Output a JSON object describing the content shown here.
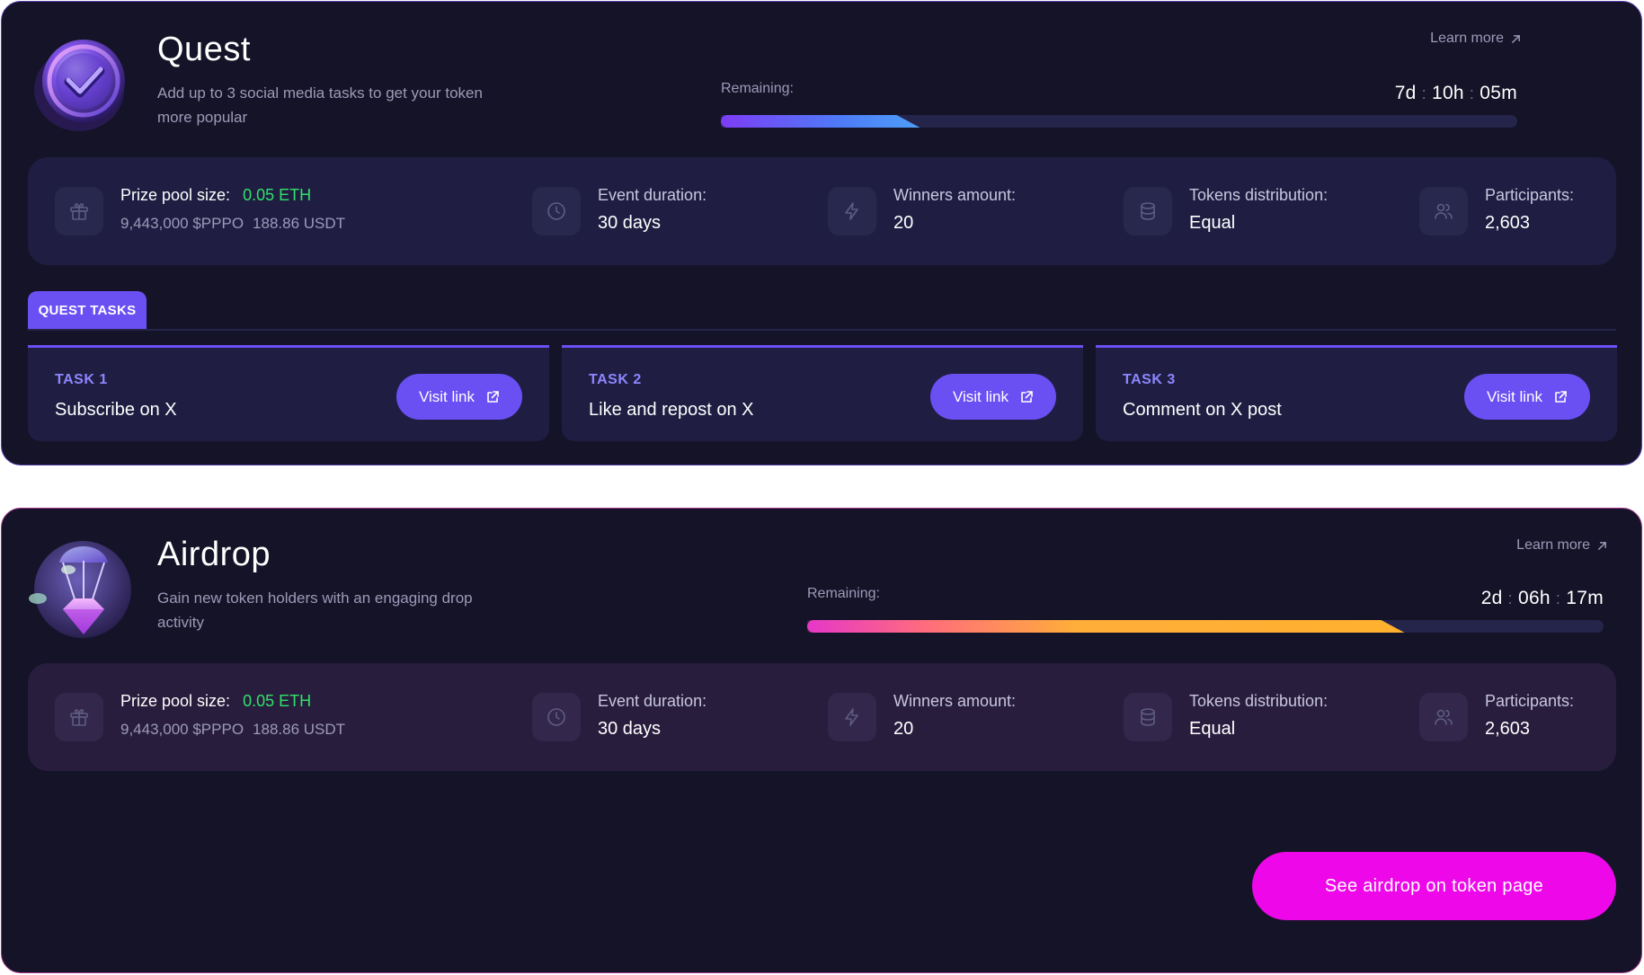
{
  "quest": {
    "title": "Quest",
    "subtitle": "Add up to 3 social media tasks to get your token more popular",
    "learn_more": "Learn more",
    "remaining_label": "Remaining:",
    "timer": {
      "days": "7d",
      "hours": "10h",
      "minutes": "05m"
    },
    "progress_fraction": 0.25,
    "stats": {
      "prize_label": "Prize pool size:",
      "prize_eth": "0.05 ETH",
      "prize_token": "9,443,000 $PPPO",
      "prize_usdt": "188.86 USDT",
      "duration_label": "Event duration:",
      "duration_value": "30 days",
      "winners_label": "Winners amount:",
      "winners_value": "20",
      "distribution_label": "Tokens distribution:",
      "distribution_value": "Equal",
      "participants_label": "Participants:",
      "participants_value": "2,603"
    },
    "tasks_tab": "QUEST TASKS",
    "tasks": [
      {
        "label": "TASK 1",
        "text": "Subscribe on X",
        "button": "Visit link"
      },
      {
        "label": "TASK 2",
        "text": "Like and repost on X",
        "button": "Visit link"
      },
      {
        "label": "TASK 3",
        "text": "Comment on X post",
        "button": "Visit link"
      }
    ]
  },
  "airdrop": {
    "title": "Airdrop",
    "subtitle": "Gain new token holders with an engaging drop activity",
    "learn_more": "Learn more",
    "remaining_label": "Remaining:",
    "timer": {
      "days": "2d",
      "hours": "06h",
      "minutes": "17m"
    },
    "progress_fraction": 0.75,
    "stats": {
      "prize_label": "Prize pool size:",
      "prize_eth": "0.05 ETH",
      "prize_token": "9,443,000 $PPPO",
      "prize_usdt": "188.86 USDT",
      "duration_label": "Event duration:",
      "duration_value": "30 days",
      "winners_label": "Winners amount:",
      "winners_value": "20",
      "distribution_label": "Tokens distribution:",
      "distribution_value": "Equal",
      "participants_label": "Participants:",
      "participants_value": "2,603"
    },
    "cta_button": "See airdrop on token page"
  },
  "colors": {
    "card_bg": "#141327",
    "accent_purple": "#6a4ff3",
    "accent_magenta": "#ee07e9",
    "eth_green": "#33e06a",
    "quest_border": "#5a3fb0",
    "airdrop_border": "#9b2f86"
  },
  "icons": [
    "check-badge-icon",
    "parachute-gem-icon",
    "arrow-up-right-icon",
    "gift-icon",
    "clock-icon",
    "lightning-icon",
    "database-icon",
    "users-icon",
    "external-link-icon"
  ]
}
